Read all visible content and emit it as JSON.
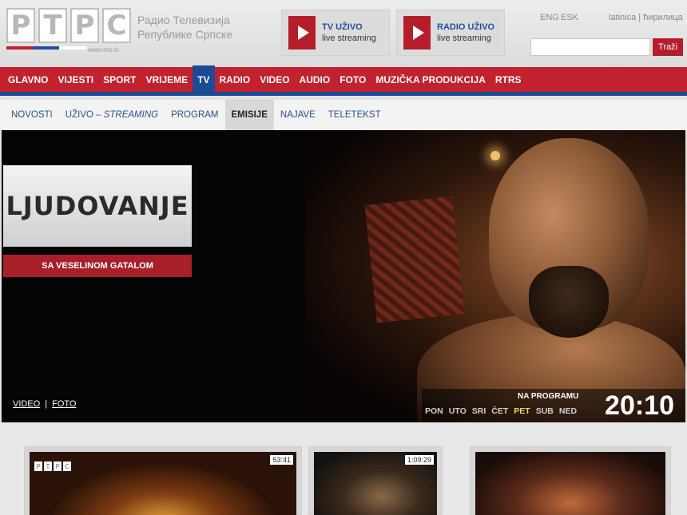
{
  "header": {
    "logo_letters": [
      "Р",
      "Т",
      "Р",
      "С"
    ],
    "logo_url": "www.rtrs.tv",
    "brand_line1": "Радио Телевизија",
    "brand_line2": "Републике Српске",
    "tv_live": {
      "title": "TV UŽIVO",
      "subtitle": "live streaming"
    },
    "radio_live": {
      "title": "RADIO UŽIVO",
      "subtitle": "live streaming"
    },
    "lang_1": "ENG",
    "lang_2": "ESK",
    "lang_3": "latinica | ћирилица",
    "search_placeholder": "",
    "search_button": "Traži"
  },
  "main_nav": [
    "GLAVNO",
    "VIJESTI",
    "SPORT",
    "VRIJEME",
    "TV",
    "RADIO",
    "VIDEO",
    "AUDIO",
    "FOTO",
    "MUZIČKA PRODUKCIJA",
    "RTRS"
  ],
  "sub_nav": {
    "novosti": "NOVOSTI",
    "uzivo": "UŽIVO –",
    "streaming": "STREAMING",
    "program": "PROGRAM",
    "emisije": "EMISIJE",
    "najave": "NAJAVE",
    "teletekst": "TELETEKST"
  },
  "hero": {
    "show_title": "LJUDOVANJE",
    "show_subtitle": "SA VESELINOM GATALOM",
    "link_video": "VIDEO",
    "link_foto": "FOTO",
    "program_label": "NA PROGRAMU",
    "days": [
      "PON",
      "UTO",
      "SRI",
      "ČET",
      "PET",
      "SUB",
      "NED"
    ],
    "active_day": "PET",
    "time": "20:10"
  },
  "thumbs": [
    {
      "duration": "53:41"
    },
    {
      "duration": "1:09:29"
    },
    {
      "duration": ""
    }
  ],
  "colors": {
    "brand_red": "#c1222e",
    "brand_blue": "#1c4b96",
    "day_active": "#f3d36b"
  }
}
